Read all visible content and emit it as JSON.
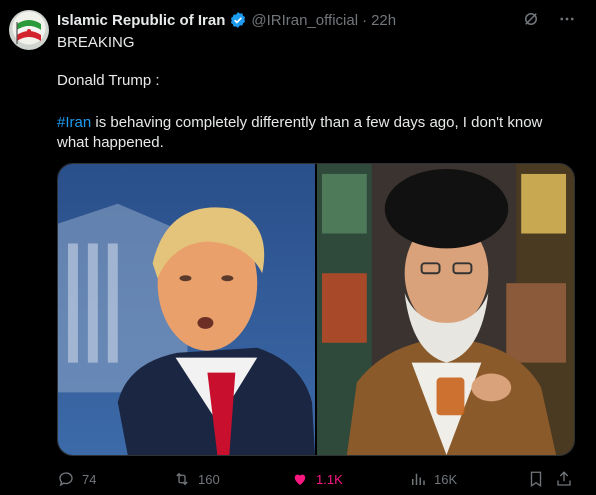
{
  "author": {
    "display_name": "Islamic Republic of Iran",
    "handle": "@IRIran_official",
    "separator": "·",
    "time": "22h",
    "verified": true
  },
  "post": {
    "line1": "BREAKING",
    "line2": "Donald Trump :",
    "hashtag": "#Iran",
    "body": " is behaving completely differently than a few days ago, I don't know what happened."
  },
  "media": {
    "images": [
      "photo-left",
      "photo-right"
    ]
  },
  "stats": {
    "replies": "74",
    "reposts": "160",
    "likes": "1.1K",
    "views": "16K"
  },
  "icons": {
    "top": [
      "grok-icon",
      "more-icon"
    ],
    "actions": [
      "reply-icon",
      "repost-icon",
      "like-icon",
      "views-icon",
      "bookmark-icon",
      "share-icon"
    ]
  },
  "colors": {
    "background": "#000000",
    "text": "#e7e9ea",
    "muted": "#71767b",
    "link": "#1d9bf0",
    "like": "#f91880",
    "verified": "#1d9bf0"
  }
}
